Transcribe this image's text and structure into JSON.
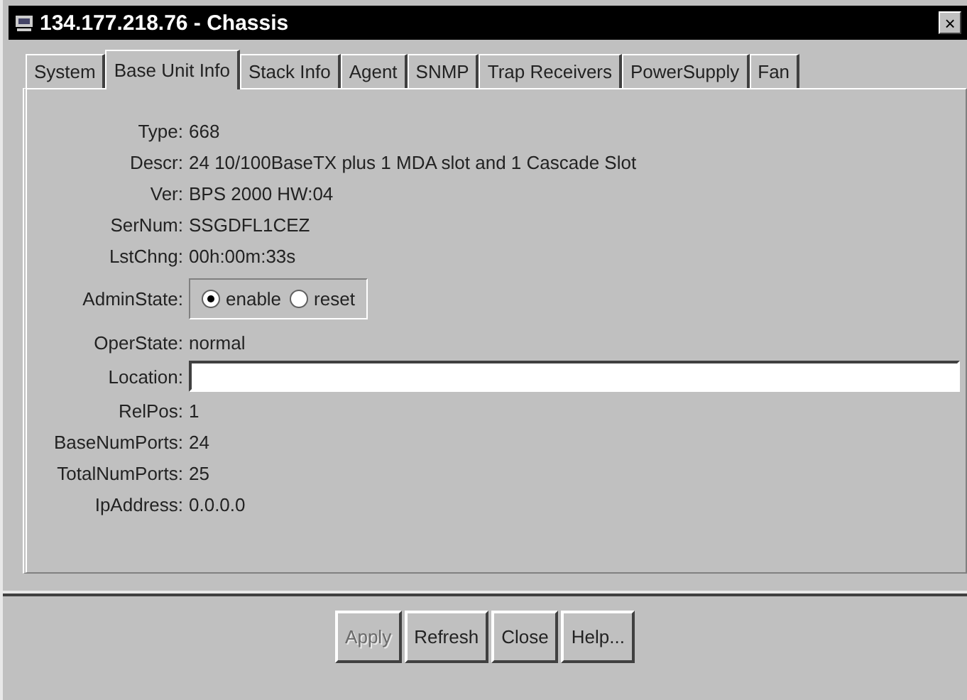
{
  "window": {
    "title": "134.177.218.76 - Chassis",
    "close": "×"
  },
  "tabs": [
    {
      "label": "System",
      "selected": false
    },
    {
      "label": "Base Unit Info",
      "selected": true
    },
    {
      "label": "Stack Info",
      "selected": false
    },
    {
      "label": "Agent",
      "selected": false
    },
    {
      "label": "SNMP",
      "selected": false
    },
    {
      "label": "Trap Receivers",
      "selected": false
    },
    {
      "label": "PowerSupply",
      "selected": false
    },
    {
      "label": "Fan",
      "selected": false
    }
  ],
  "fields": [
    {
      "kind": "text",
      "label": "Type:",
      "value": "668"
    },
    {
      "kind": "text",
      "label": "Descr:",
      "value": "24 10/100BaseTX plus 1 MDA slot and 1 Cascade Slot"
    },
    {
      "kind": "text",
      "label": "Ver:",
      "value": "BPS 2000 HW:04"
    },
    {
      "kind": "text",
      "label": "SerNum:",
      "value": "SSGDFL1CEZ"
    },
    {
      "kind": "text",
      "label": "LstChng:",
      "value": "00h:00m:33s"
    },
    {
      "kind": "radio",
      "label": "AdminState:",
      "options": [
        {
          "label": "enable",
          "selected": true
        },
        {
          "label": "reset",
          "selected": false
        }
      ]
    },
    {
      "kind": "text",
      "label": "OperState:",
      "value": "normal"
    },
    {
      "kind": "input",
      "label": "Location:"
    },
    {
      "kind": "text",
      "label": "RelPos:",
      "value": "1"
    },
    {
      "kind": "text",
      "label": "BaseNumPorts:",
      "value": "24"
    },
    {
      "kind": "text",
      "label": "TotalNumPorts:",
      "value": "25"
    },
    {
      "kind": "text",
      "label": "IpAddress:",
      "value": "0.0.0.0"
    }
  ],
  "buttons": [
    {
      "label": "Apply",
      "disabled": true
    },
    {
      "label": "Refresh",
      "disabled": false
    },
    {
      "label": "Close",
      "disabled": false
    },
    {
      "label": "Help...",
      "disabled": false
    }
  ]
}
